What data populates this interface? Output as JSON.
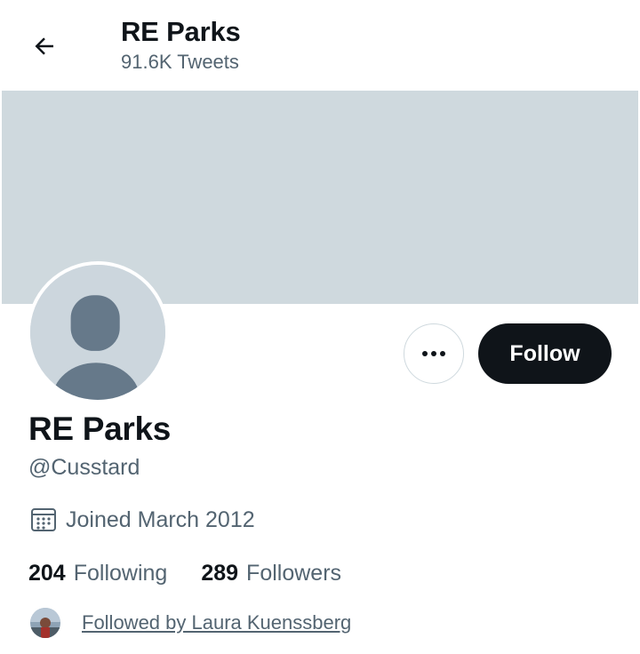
{
  "header": {
    "title": "RE Parks",
    "tweet_count": "91.6K Tweets"
  },
  "colors": {
    "banner": "#cfd9de",
    "primary_text": "#0f1419",
    "secondary_text": "#536471",
    "follow_button_bg": "#0f1419",
    "follow_button_text": "#ffffff"
  },
  "icons": {
    "back": "arrow-left-icon",
    "more": "ellipsis-icon",
    "calendar": "calendar-icon",
    "avatar": "default-avatar-icon"
  },
  "profile": {
    "display_name": "RE Parks",
    "handle": "@Cusstard",
    "joined": "Joined March 2012",
    "following_count": "204",
    "following_label": "Following",
    "followers_count": "289",
    "followers_label": "Followers",
    "followed_by": "Followed by Laura Kuenssberg"
  },
  "actions": {
    "follow_label": "Follow"
  }
}
